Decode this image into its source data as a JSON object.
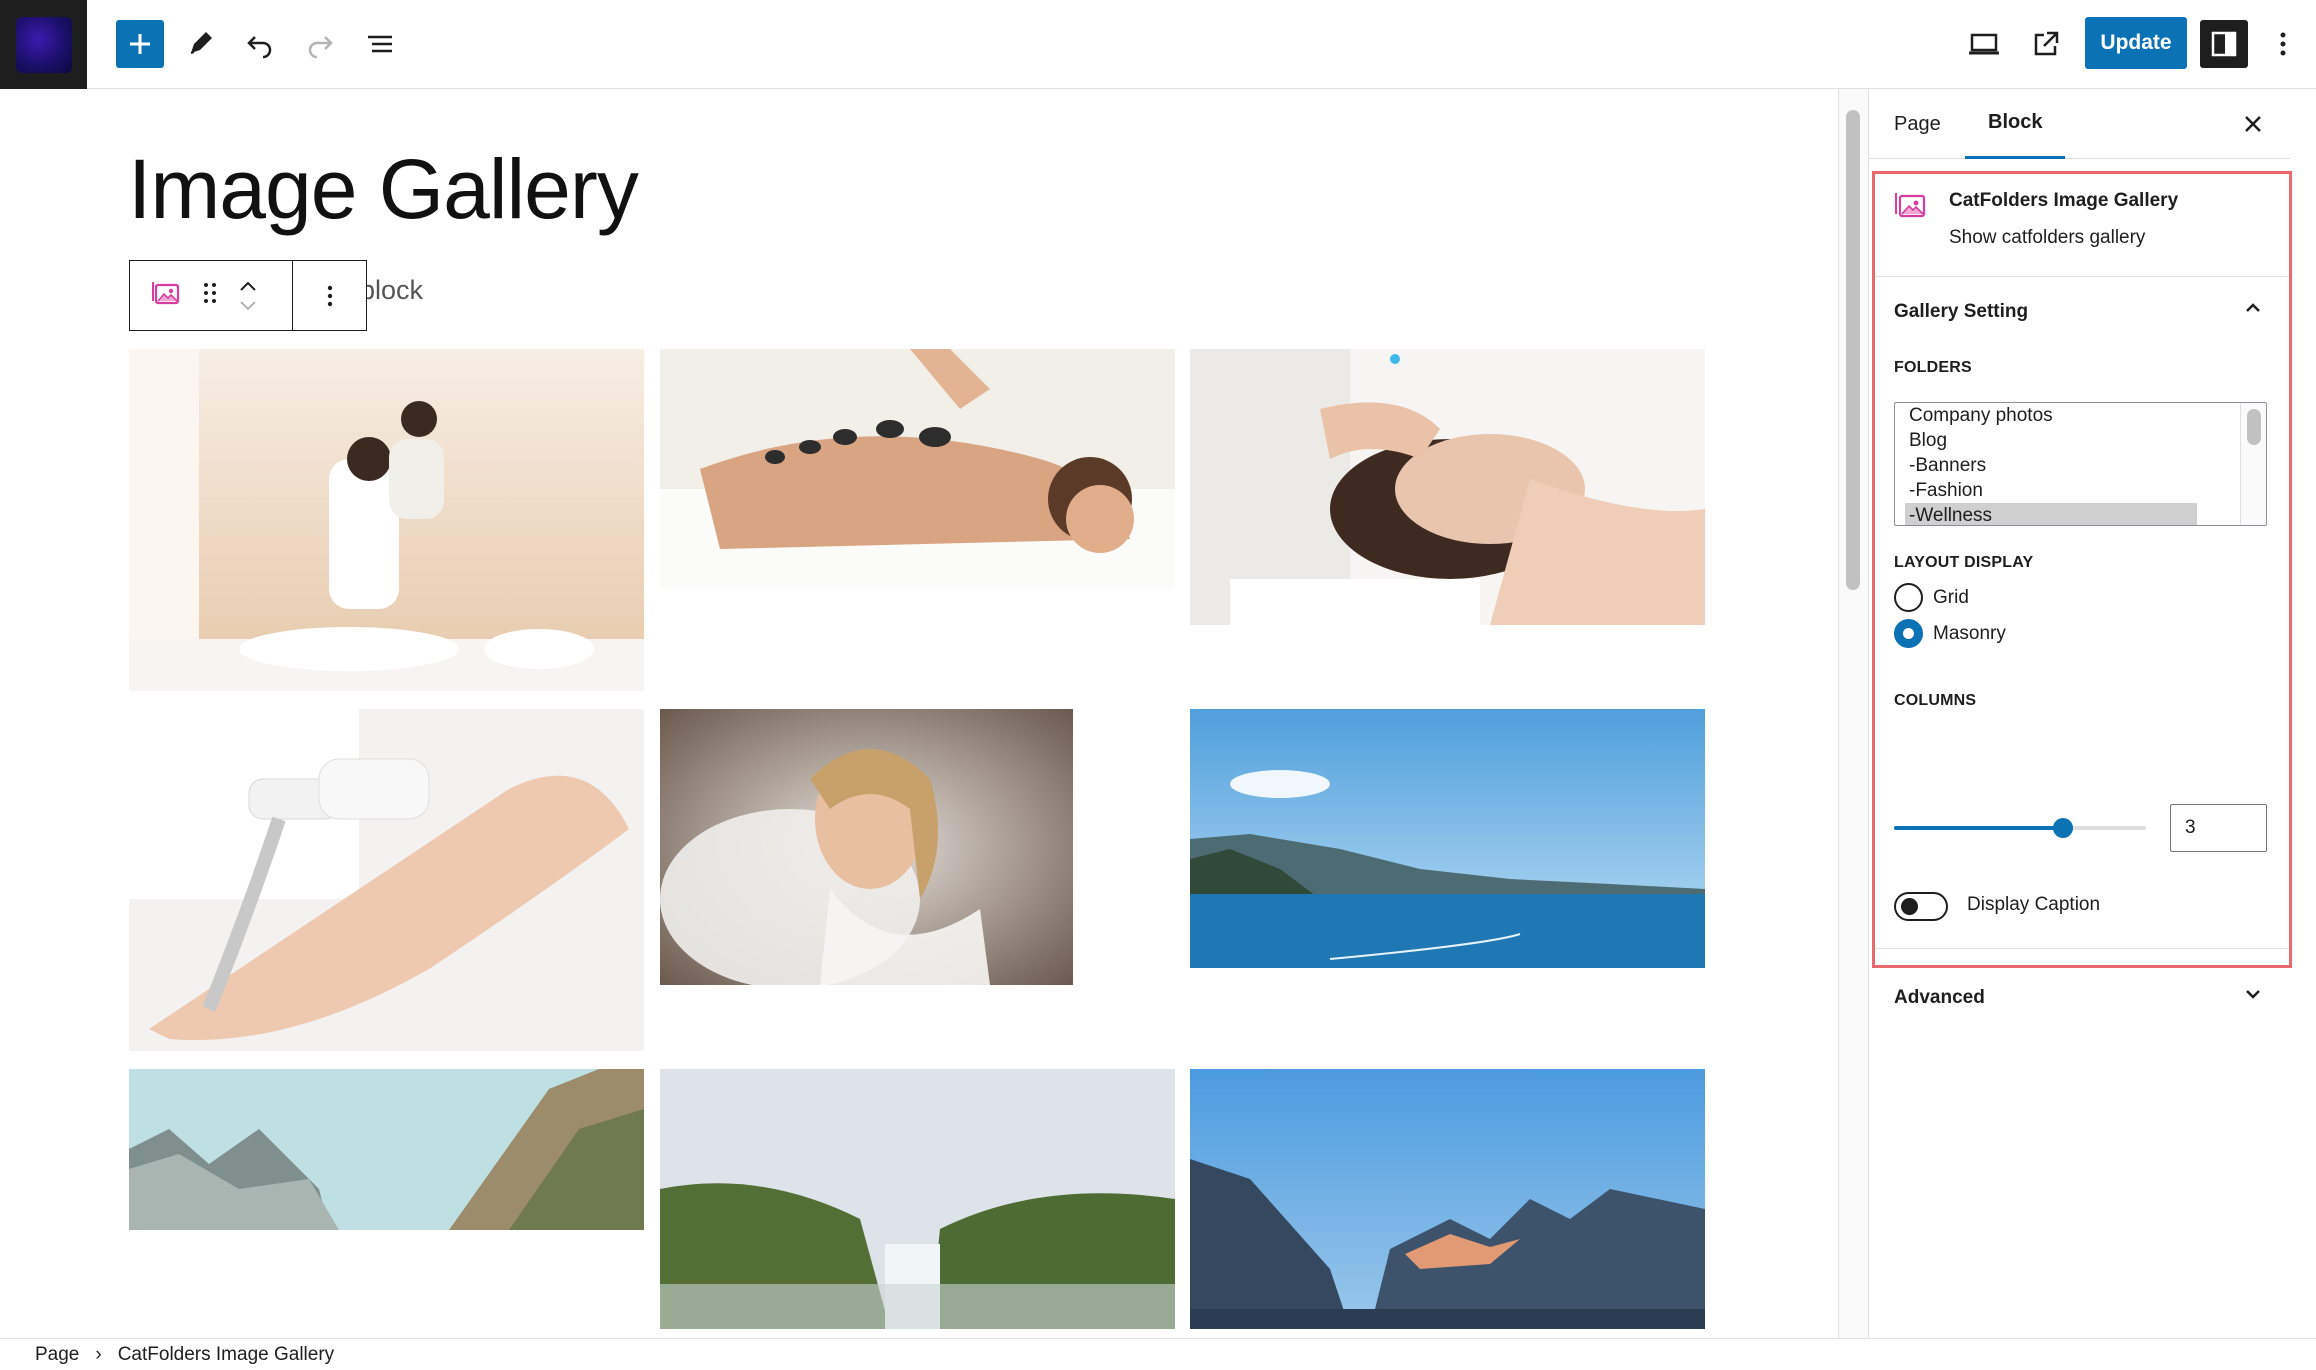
{
  "toolbar": {
    "update_label": "Update"
  },
  "editor": {
    "title": "Image Gallery",
    "placeholder_fragment": "block"
  },
  "gallery": {
    "images": [
      {
        "alt": "thai-massage",
        "colors": [
          "#f3ebe1",
          "#e8cfb3",
          "#ffffff"
        ]
      },
      {
        "alt": "hot-stone-massage",
        "colors": [
          "#f2ede7",
          "#d8ad8c",
          "#ffffff"
        ]
      },
      {
        "alt": "facial-massage",
        "colors": [
          "#f5f2ef",
          "#e4c3ad",
          "#ffffff"
        ]
      },
      {
        "alt": "leg-laser-treatment",
        "colors": [
          "#f4f2f0",
          "#ecd0bd",
          "#ffffff"
        ]
      },
      {
        "alt": "bride-veil",
        "colors": [
          "#c9c3bb",
          "#e9d4c4",
          "#6d5548"
        ]
      },
      {
        "alt": "lake-mountains",
        "colors": [
          "#6ab0e4",
          "#2b7fbd",
          "#1d6fa6"
        ]
      },
      {
        "alt": "rocky-mountains",
        "colors": [
          "#b8dbe0",
          "#9aa79c",
          "#8c7b62"
        ]
      },
      {
        "alt": "waterfall",
        "colors": [
          "#dfe5ea",
          "#5e7a3c",
          "#3f5a2c"
        ]
      },
      {
        "alt": "mountain-valley",
        "colors": [
          "#5aa2d6",
          "#3c5470",
          "#263850"
        ]
      }
    ]
  },
  "sidebar": {
    "tabs": [
      {
        "label": "Page"
      },
      {
        "label": "Block"
      }
    ],
    "block": {
      "name": "CatFolders Image Gallery",
      "description": "Show catfolders gallery"
    },
    "gallery_setting": {
      "title": "Gallery Setting",
      "folders_label": "FOLDERS",
      "folders": [
        "Company photos",
        "Blog",
        "-Banners",
        "-Fashion",
        "-Wellness"
      ],
      "selected_folder": "-Wellness",
      "layout_label": "LAYOUT DISPLAY",
      "layout_options": [
        {
          "label": "Grid",
          "checked": false
        },
        {
          "label": "Masonry",
          "checked": true
        }
      ],
      "columns_label": "COLUMNS",
      "columns_value": "3",
      "columns_fraction": 0.67,
      "display_caption_label": "Display Caption",
      "display_caption_on": false
    },
    "advanced": {
      "title": "Advanced"
    }
  },
  "footer": {
    "breadcrumb": [
      "Page",
      "CatFolders Image Gallery"
    ]
  },
  "colors": {
    "accent": "#0c72b6",
    "highlight": "#e86a6d",
    "dark": "#1e1e1e"
  }
}
